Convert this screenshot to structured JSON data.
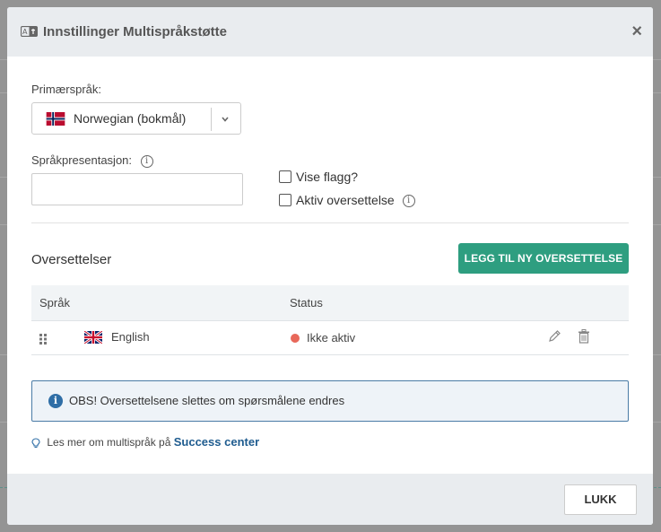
{
  "header": {
    "title": "Innstillinger Multispråkstøtte",
    "icon": "translate-icon",
    "close_symbol": "×"
  },
  "primary_language": {
    "label": "Primærspråk:",
    "selected": "Norwegian (bokmål)",
    "flag": "norway-flag-icon"
  },
  "presentation": {
    "label": "Språkpresentasjon:",
    "value": ""
  },
  "options": {
    "show_flag_label": "Vise flagg?",
    "show_flag_checked": false,
    "active_translation_label": "Aktiv oversettelse",
    "active_translation_checked": false
  },
  "translations": {
    "title": "Oversettelser",
    "add_button": "LEGG TIL NY OVERSETTELSE",
    "columns": [
      "Språk",
      "Status"
    ],
    "rows": [
      {
        "language": "English",
        "flag": "uk-flag-icon",
        "status": "Ikke aktiv",
        "status_color": "#e8685a"
      }
    ]
  },
  "alert": {
    "icon_glyph": "i",
    "text": "OBS! Oversettelsene slettes om spørsmålene endres"
  },
  "help": {
    "text": "Les mer om multispråk på",
    "link": "Success center"
  },
  "footer": {
    "close_button": "LUKK"
  },
  "colors": {
    "primary_button": "#2e9e80",
    "alert_border": "#4a7ba6",
    "link": "#1f5c8f",
    "status_inactive": "#e8685a"
  }
}
